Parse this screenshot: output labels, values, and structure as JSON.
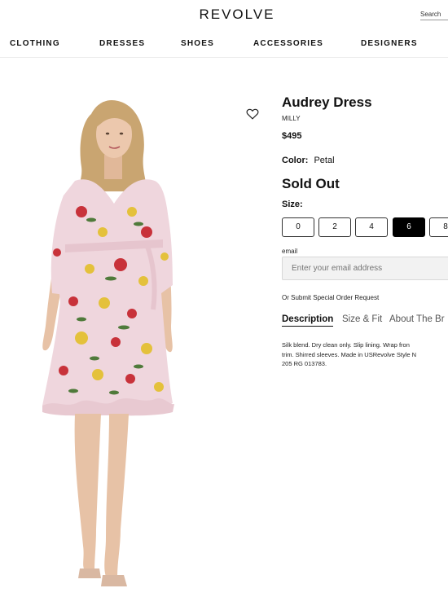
{
  "header": {
    "logo": "REVOLVE",
    "search_label": "Search"
  },
  "nav": {
    "items": [
      "CLOTHING",
      "DRESSES",
      "SHOES",
      "ACCESSORIES",
      "DESIGNERS"
    ]
  },
  "product": {
    "title": "Audrey Dress",
    "brand": "MILLY",
    "price": "$495",
    "color_label": "Color:",
    "color_value": "Petal",
    "availability": "Sold Out",
    "size_label": "Size:",
    "sizes": [
      "0",
      "2",
      "4",
      "6",
      "8"
    ],
    "selected_size": "6",
    "email_label": "email",
    "email_placeholder": "Enter your email address",
    "special_order_link": "Or Submit Special Order Request",
    "tabs": [
      "Description",
      "Size & Fit",
      "About The Br"
    ],
    "active_tab": "Description",
    "description_lines": [
      "Silk blend. Dry clean only. Slip lining. Wrap fron",
      "trim. Shirred sleeves. Made in USRevolve Style N",
      "205 RG 013783."
    ]
  },
  "colors": {
    "accent": "#000000",
    "dress_base": "#efd6dd",
    "flower_red": "#c8323a",
    "flower_yellow": "#e4c13b",
    "leaf_green": "#4f7a3a",
    "skin": "#e7c2a6",
    "hair": "#c9a571"
  },
  "icons": {
    "wishlist": "heart-icon"
  }
}
